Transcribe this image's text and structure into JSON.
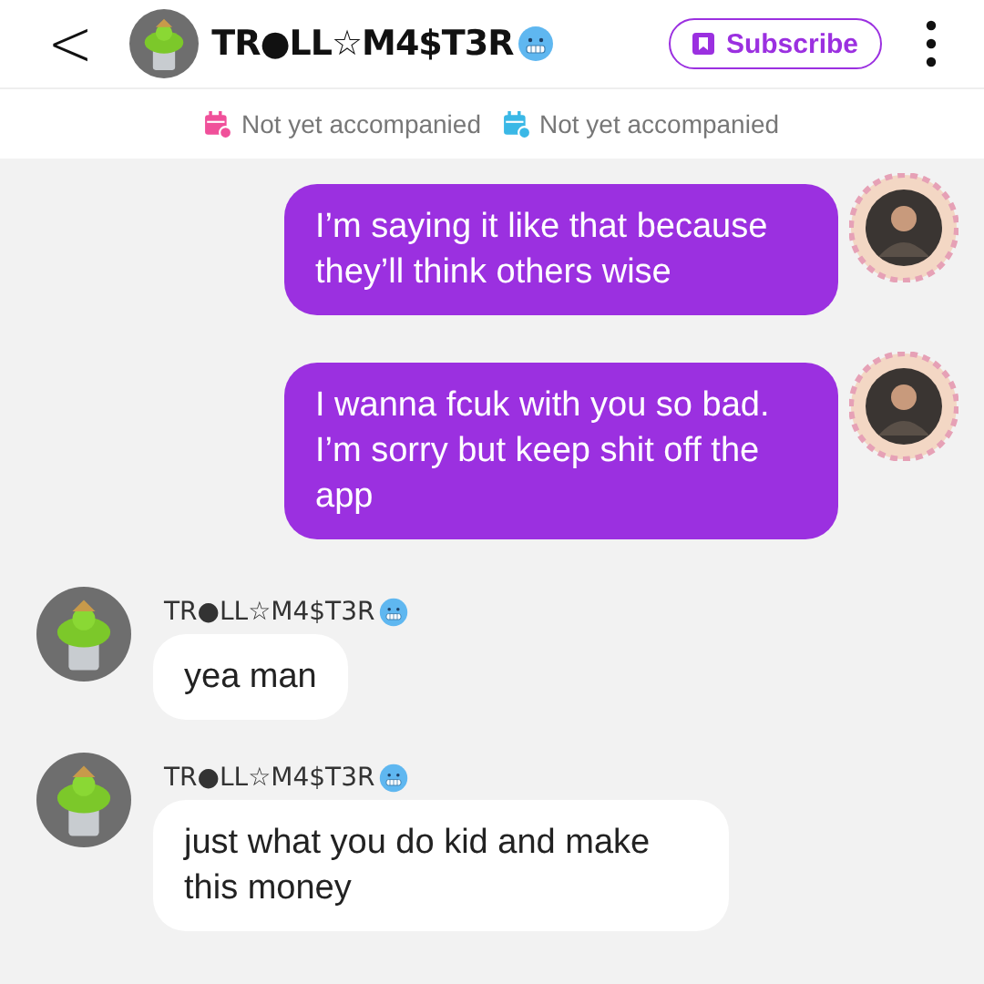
{
  "header": {
    "back": "<",
    "title": "TR●LL☆M4$T3R",
    "subscribe": "Subscribe"
  },
  "status": [
    {
      "label": "Not yet accompanied",
      "color": "#f0509a"
    },
    {
      "label": "Not yet accompanied",
      "color": "#3ab8e6"
    }
  ],
  "messages": [
    {
      "kind": "sent",
      "text": "I’m saying it like that because they’ll think others wise"
    },
    {
      "kind": "sent",
      "text": "I wanna fcuk with you so bad. I’m sorry but keep shit off the app"
    },
    {
      "kind": "received",
      "sender": "TR●LL☆M4$T3R",
      "text": "yea man"
    },
    {
      "kind": "received",
      "sender": "TR●LL☆M4$T3R",
      "text": "just what you do kid and make this money"
    }
  ]
}
